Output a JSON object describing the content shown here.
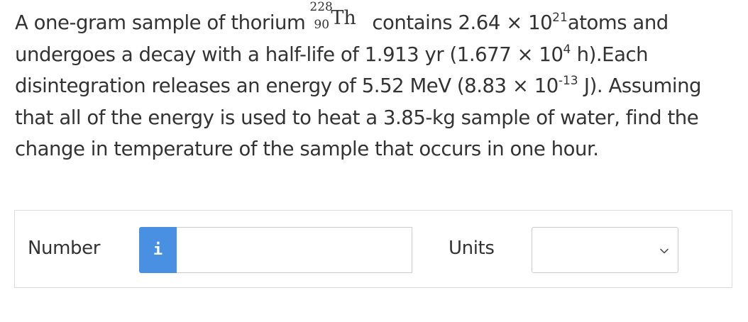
{
  "question": {
    "p1": "A one-gram sample of thorium",
    "nuclide": {
      "mass": "228",
      "atomic": "90",
      "element": "Th"
    },
    "p2": "contains 2.64 × 10",
    "exp_atoms": "21",
    "p3": "atoms and undergoes a decay with a half-life of 1.913 yr (1.677 × 10",
    "exp_hours": "4",
    "p4": " h).Each disintegration releases an energy of 5.52 MeV (8.83 × 10",
    "exp_energy": "-13",
    "p5": " J). Assuming that all of the energy is used to heat a 3.85-kg sample of water, find the change in temperature of the sample that occurs in one hour."
  },
  "answer": {
    "number_label": "Number",
    "info_label": "i",
    "number_value": "",
    "units_label": "Units",
    "units_selected": ""
  },
  "colors": {
    "info_button": "#4a90e2",
    "text": "#333333",
    "border": "#dddddd"
  },
  "icons": {
    "info": "info-icon",
    "dropdown": "chevron-down-icon"
  }
}
